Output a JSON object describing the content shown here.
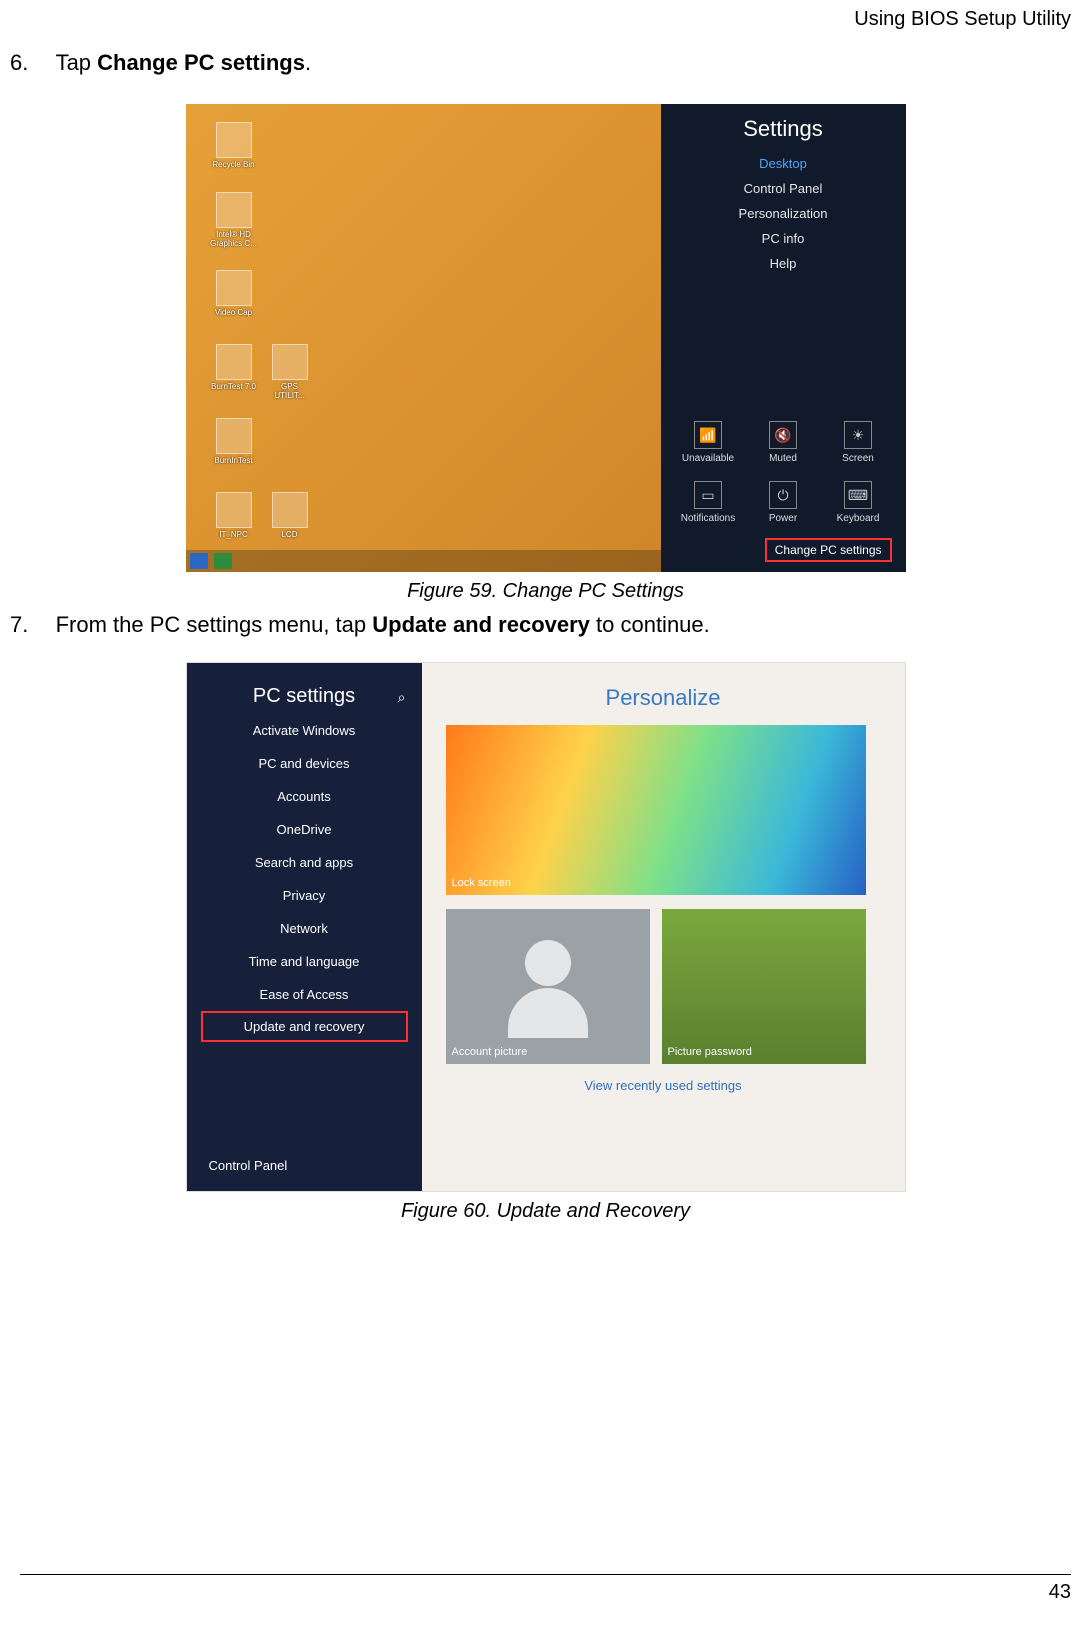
{
  "header": {
    "title": "Using BIOS Setup Utility"
  },
  "steps": [
    {
      "num": "6.",
      "pre": "Tap ",
      "bold": "Change PC settings",
      "post": "."
    },
    {
      "num": "7.",
      "pre": "From the PC settings menu, tap ",
      "bold": "Update and recovery",
      "post": " to continue."
    }
  ],
  "fig59": {
    "caption": "Figure 59.  Change PC Settings",
    "charms_title": "Settings",
    "charms_items": [
      "Desktop",
      "Control Panel",
      "Personalization",
      "PC info",
      "Help"
    ],
    "quick1": [
      {
        "label": "Unavailable",
        "icon": "📶"
      },
      {
        "label": "Muted",
        "icon": "🔇"
      },
      {
        "label": "Screen",
        "icon": "☀"
      }
    ],
    "quick2": [
      {
        "label": "Notifications",
        "icon": "▭"
      },
      {
        "label": "Power",
        "icon": "⏻"
      },
      {
        "label": "Keyboard",
        "icon": "⌨"
      }
    ],
    "change_pc": "Change PC settings",
    "desktop_icons": [
      "Recycle Bin",
      "Intel® HD Graphics C...",
      "Video Cap",
      "BurnTest 7.0",
      "GPS UTILIT...",
      "BurnInTest",
      "IT_NPC",
      "LCD"
    ]
  },
  "fig60": {
    "caption": "Figure 60.  Update and Recovery",
    "side_title": "PC settings",
    "side_items": [
      "Activate Windows",
      "PC and devices",
      "Accounts",
      "OneDrive",
      "Search and apps",
      "Privacy",
      "Network",
      "Time and language",
      "Ease of Access"
    ],
    "highlight_item": "Update and recovery",
    "side_bottom": "Control Panel",
    "main_title": "Personalize",
    "tiles": {
      "lock": "Lock screen",
      "account": "Account picture",
      "picpwd": "Picture password"
    },
    "link": "View recently used settings"
  },
  "page_number": "43"
}
